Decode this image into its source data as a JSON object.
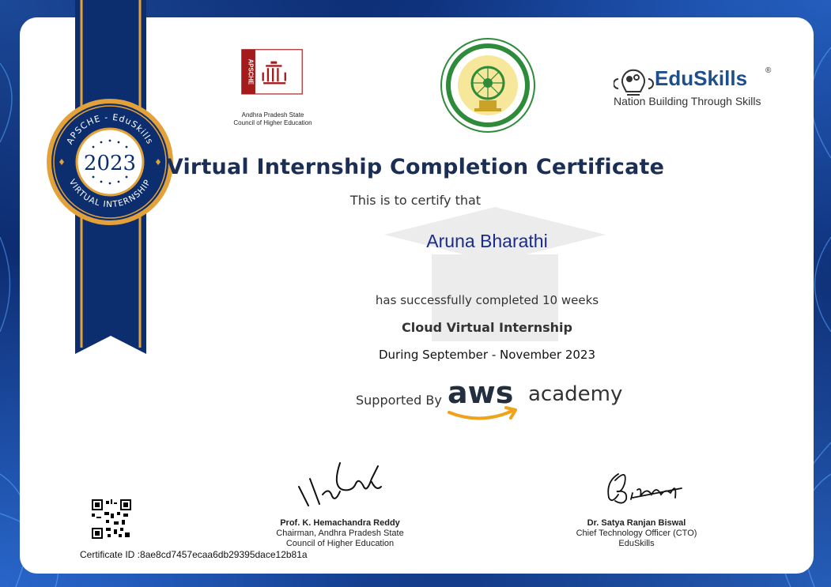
{
  "seal": {
    "top_text": "APSCHE - EduSkills",
    "year": "2023",
    "bottom_text": "VIRTUAL INTERNSHIP"
  },
  "logos": {
    "apsche_letters": "APSCHE",
    "apsche_caption_line1": "Andhra Pradesh State",
    "apsche_caption_line2": "Council of Higher Education",
    "eduskills_name": "EduSkills",
    "eduskills_tagline": "Nation Building Through Skills",
    "eduskills_reg": "®"
  },
  "certificate": {
    "title": "Virtual Internship Completion Certificate",
    "certify_text": "This is to certify that",
    "recipient_name": "Aruna Bharathi",
    "completed_text": "has successfully completed 10 weeks",
    "program": "Cloud Virtual Internship",
    "duration": "During September - November 2023",
    "supported_by": "Supported By",
    "aws_text": "aws",
    "academy_text": "academy"
  },
  "signatories": [
    {
      "name": "Prof. K. Hemachandra Reddy",
      "line1": "Chairman, Andhra Pradesh State",
      "line2": "Council of Higher Education"
    },
    {
      "name": "Dr. Satya Ranjan Biswal",
      "line1": "Chief Technology Officer (CTO)",
      "line2": "EduSkills"
    }
  ],
  "certificate_id": "Certificate ID :8ae8cd7457ecaa6db29395dace12b81a",
  "colors": {
    "background": "#0b2a6b",
    "ribbon": "#0c2e6e",
    "gold": "#e3a13a",
    "title": "#1b2f56",
    "name": "#1a2b8c",
    "apsche_red": "#a51b1b",
    "aws_orange": "#f0a21a"
  }
}
